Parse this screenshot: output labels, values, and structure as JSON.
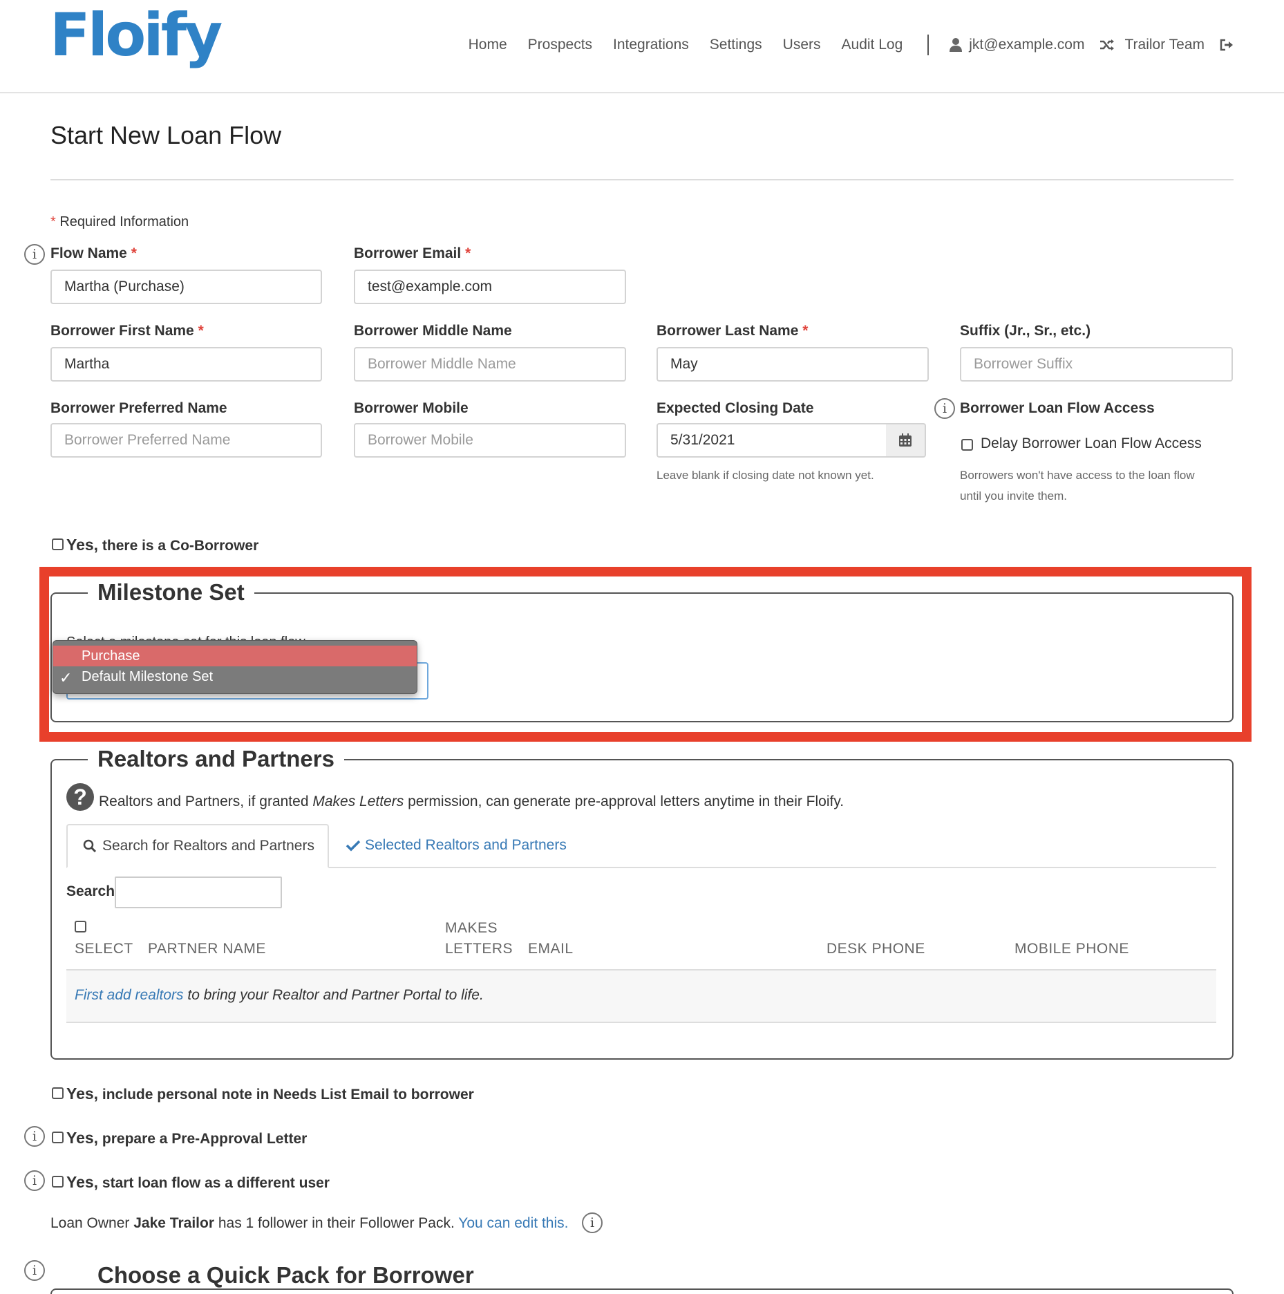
{
  "header": {
    "logo": "Floify",
    "nav": [
      "Home",
      "Prospects",
      "Integrations",
      "Settings",
      "Users",
      "Audit Log"
    ],
    "user_email": "jkt@example.com",
    "team": "Trailor Team"
  },
  "page": {
    "title": "Start New Loan Flow",
    "required_star": "*",
    "required_note": "Required Information"
  },
  "form": {
    "flow_name": {
      "label": "Flow Name",
      "value": "Martha (Purchase)"
    },
    "borrower_email": {
      "label": "Borrower Email",
      "value": "test@example.com"
    },
    "first_name": {
      "label": "Borrower First Name",
      "value": "Martha"
    },
    "middle_name": {
      "label": "Borrower Middle Name",
      "placeholder": "Borrower Middle Name"
    },
    "last_name": {
      "label": "Borrower Last Name",
      "value": "May"
    },
    "suffix": {
      "label": "Suffix (Jr., Sr., etc.)",
      "placeholder": "Borrower Suffix"
    },
    "preferred_name": {
      "label": "Borrower Preferred Name",
      "placeholder": "Borrower Preferred Name"
    },
    "mobile": {
      "label": "Borrower Mobile",
      "placeholder": "Borrower Mobile"
    },
    "closing_date": {
      "label": "Expected Closing Date",
      "value": "5/31/2021",
      "help": "Leave blank if closing date not known yet."
    },
    "access": {
      "label": "Borrower Loan Flow Access",
      "checkbox_label": "Delay Borrower Loan Flow Access",
      "help_line1": "Borrowers won't have access to the loan flow",
      "help_line2": "until you invite them."
    },
    "co_borrower": {
      "bold": "Yes,",
      "text": "there is a Co-Borrower"
    }
  },
  "milestone": {
    "legend": "Milestone Set",
    "hidden_label": "Select a milestone set for this loan flow",
    "options": [
      {
        "label": "Purchase",
        "highlighted": true,
        "selected": false
      },
      {
        "label": "Default Milestone Set",
        "highlighted": false,
        "selected": true
      }
    ],
    "check_glyph": "✓",
    "highlight_color": "#e8402b"
  },
  "realtors": {
    "legend": "Realtors and Partners",
    "help_glyph": "?",
    "description_pre": "Realtors and Partners, if granted ",
    "description_em": "Makes Letters",
    "description_post": " permission, can generate pre-approval letters anytime in their Floify.",
    "tab_search": "Search for Realtors and Partners",
    "tab_selected": "Selected Realtors and Partners",
    "search_label": "Search",
    "columns": {
      "select": "SELECT",
      "partner_name": "PARTNER NAME",
      "makes_line1": "MAKES",
      "makes_line2": "LETTERS",
      "email": "EMAIL",
      "desk_phone": "DESK PHONE",
      "mobile_phone": "MOBILE PHONE"
    },
    "empty_link": "First add realtors",
    "empty_text": " to bring your Realtor and Partner Portal to life."
  },
  "options": {
    "personal_note": {
      "bold": "Yes,",
      "text": "include personal note in Needs List Email to borrower"
    },
    "pre_approval": {
      "bold": "Yes,",
      "text": "prepare a Pre-Approval Letter"
    },
    "different_user": {
      "bold": "Yes,",
      "text": "start loan flow as a different user"
    }
  },
  "owner": {
    "pre": "Loan Owner ",
    "name": "Jake Trailor",
    "post": " has 1 follower in their Follower Pack. ",
    "link": "You can edit this."
  },
  "quick_pack": {
    "legend": "Choose a Quick Pack for Borrower"
  },
  "colors": {
    "brand": "#2f82c6",
    "link": "#3779b5",
    "required": "#e0433b"
  }
}
